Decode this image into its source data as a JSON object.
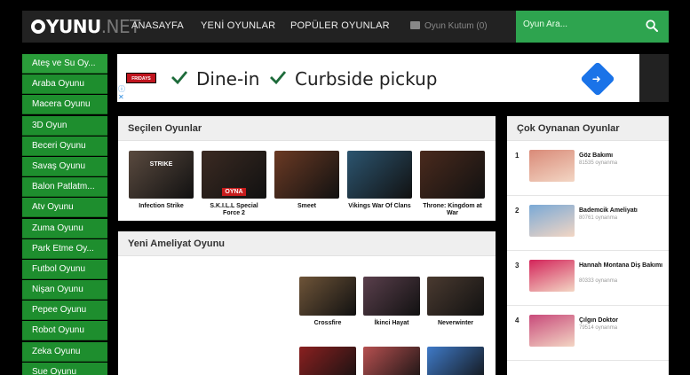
{
  "header": {
    "logo": "OYUNU",
    "logo_suffix": ".NET",
    "nav": [
      "ANASAYFA",
      "YENİ OYUNLAR",
      "POPÜLER OYUNLAR"
    ],
    "oyun_kutum": "Oyun Kutum (0)",
    "search_placeholder": "Oyun Ara..."
  },
  "sidebar": {
    "categories": [
      "Ateş ve Su Oy...",
      "Araba Oyunu",
      "Macera Oyunu",
      "3D Oyun",
      "Beceri Oyunu",
      "Savaş Oyunu",
      "Balon Patlatm...",
      "Atv Oyunu",
      "Zuma Oyunu",
      "Park Etme Oy...",
      "Futbol Oyunu",
      "Nişan Oyunu",
      "Pepee Oyunu",
      "Robot Oyunu",
      "Zeka Oyunu",
      "Sue Oyunu"
    ]
  },
  "ad": {
    "brand": "FRIDAYS",
    "item1": "Dine-in",
    "item2": "Curbside pickup"
  },
  "selected": {
    "title": "Seçilen Oyunlar",
    "games": [
      {
        "name": "Infection Strike",
        "thumb_text": "STRIKE",
        "color": "#5a4a3f"
      },
      {
        "name": "S.K.I.L.L Special Force 2",
        "thumb_text": "OYNA",
        "color": "#3b2a22"
      },
      {
        "name": "Smeet",
        "thumb_text": "",
        "color": "#6b3a24"
      },
      {
        "name": "Vikings War Of Clans",
        "thumb_text": "",
        "color": "#2c5570"
      },
      {
        "name": "Throne: Kingdom at War",
        "thumb_text": "",
        "color": "#4a2a1d"
      }
    ]
  },
  "ameliyat": {
    "title": "Yeni Ameliyat Oyunu",
    "games": [
      {
        "name": "Crossfire",
        "color": "#6e5438"
      },
      {
        "name": "İkinci Hayat",
        "color": "#5a3f4c"
      },
      {
        "name": "Neverwinter",
        "color": "#4a3a30"
      }
    ],
    "row2_colors": [
      "#8a2020",
      "#b65050",
      "#3f7ac8"
    ]
  },
  "popular": {
    "title": "Çok Oynanan Oyunlar",
    "items": [
      {
        "rank": "1",
        "name": "Göz Bakımı",
        "plays": "81535 oynanma",
        "color": "#d98a78"
      },
      {
        "rank": "2",
        "name": "Bademcik Ameliyatı",
        "plays": "80761 oynanma",
        "color": "#7aa9d6"
      },
      {
        "rank": "3",
        "name": "Hannah Montana Diş Bakımı",
        "plays": "80333 oynanma",
        "color": "#d3245a"
      },
      {
        "rank": "4",
        "name": "Çılgın Doktor",
        "plays": "79514 oynanma",
        "color": "#c84a7a"
      }
    ]
  }
}
